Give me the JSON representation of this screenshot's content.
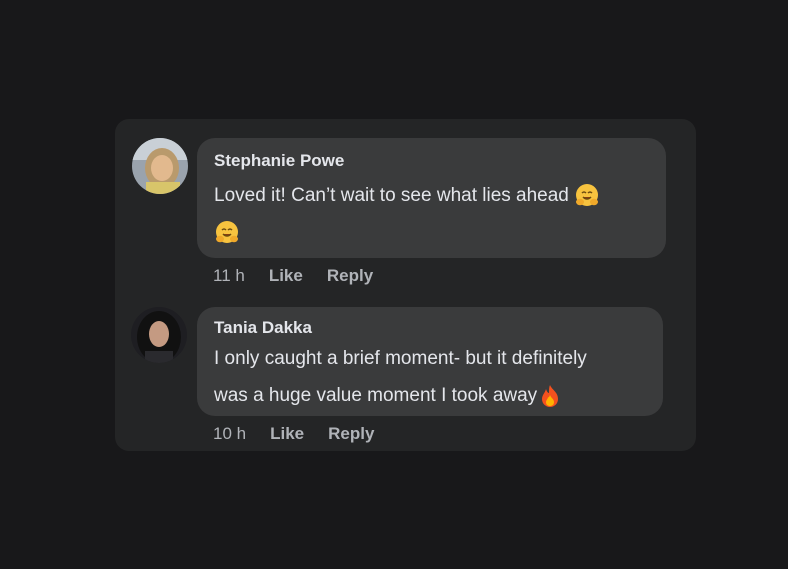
{
  "comments": [
    {
      "author": "Stephanie Powe",
      "text": "Loved it! Can’t wait to see what lies ahead",
      "emojis_inline": "hugging-face",
      "emojis_trailing": "hugging-face",
      "time": "11 h",
      "like_label": "Like",
      "reply_label": "Reply"
    },
    {
      "author": "Tania Dakka",
      "text_line1": "I only caught a brief moment- but it definitely",
      "text_line2": "was a huge value moment I took away",
      "emoji": "fire",
      "time": "10 h",
      "like_label": "Like",
      "reply_label": "Reply"
    }
  ]
}
